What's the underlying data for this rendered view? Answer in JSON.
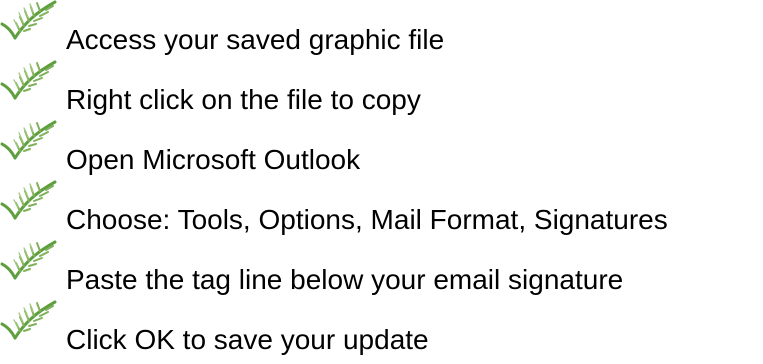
{
  "steps": [
    {
      "text": "Access your saved graphic file",
      "icon": "fern-check-icon"
    },
    {
      "text": "Right click on the file to copy",
      "icon": "fern-check-icon"
    },
    {
      "text": "Open Microsoft Outlook",
      "icon": "fern-check-icon"
    },
    {
      "text": "Choose: Tools, Options, Mail Format, Signatures",
      "icon": "fern-check-icon"
    },
    {
      "text": "Paste the tag line below your email signature",
      "icon": "fern-check-icon"
    },
    {
      "text": "Click OK to save your update",
      "icon": "fern-check-icon"
    }
  ],
  "colors": {
    "text": "#000000",
    "bullet_green": "#5f9f3f",
    "bullet_light": "#9fc77f"
  }
}
